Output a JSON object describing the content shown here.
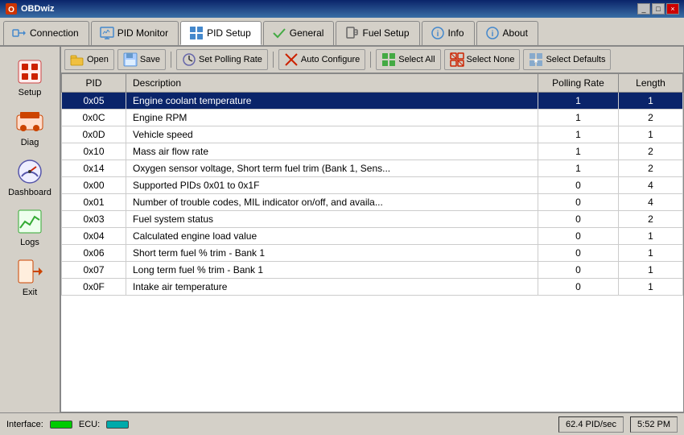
{
  "titlebar": {
    "title": "OBDwiz",
    "controls": [
      "_",
      "□",
      "×"
    ]
  },
  "nav": {
    "tabs": [
      {
        "id": "connection",
        "label": "Connection",
        "icon": "plug"
      },
      {
        "id": "pid-monitor",
        "label": "PID Monitor",
        "icon": "monitor"
      },
      {
        "id": "pid-setup",
        "label": "PID Setup",
        "icon": "grid",
        "active": true
      },
      {
        "id": "general",
        "label": "General",
        "icon": "check"
      },
      {
        "id": "fuel-setup",
        "label": "Fuel Setup",
        "icon": "fuel"
      },
      {
        "id": "info",
        "label": "Info",
        "icon": "info"
      },
      {
        "id": "about",
        "label": "About",
        "icon": "info2"
      }
    ]
  },
  "sidebar": {
    "items": [
      {
        "id": "setup",
        "label": "Setup",
        "icon": "wrench"
      },
      {
        "id": "diag",
        "label": "Diag",
        "icon": "car"
      },
      {
        "id": "dashboard",
        "label": "Dashboard",
        "icon": "gauge"
      },
      {
        "id": "logs",
        "label": "Logs",
        "icon": "graph"
      },
      {
        "id": "exit",
        "label": "Exit",
        "icon": "arrow"
      }
    ]
  },
  "toolbar": {
    "buttons": [
      {
        "id": "open",
        "label": "Open",
        "icon": "folder"
      },
      {
        "id": "save",
        "label": "Save",
        "icon": "disk"
      },
      {
        "id": "set-polling-rate",
        "label": "Set Polling Rate",
        "icon": "clock"
      },
      {
        "id": "auto-configure",
        "label": "Auto Configure",
        "icon": "x-mark"
      },
      {
        "id": "select-all",
        "label": "Select All",
        "icon": "check-grid"
      },
      {
        "id": "select-none",
        "label": "Select None",
        "icon": "x-grid"
      },
      {
        "id": "select-defaults",
        "label": "Select Defaults",
        "icon": "grid-star"
      }
    ]
  },
  "table": {
    "columns": [
      "PID",
      "Description",
      "Polling Rate",
      "Length"
    ],
    "rows": [
      {
        "pid": "0x05",
        "description": "Engine coolant temperature",
        "polling": "1",
        "length": "1",
        "selected": true
      },
      {
        "pid": "0x0C",
        "description": "Engine RPM",
        "polling": "1",
        "length": "2",
        "selected": false
      },
      {
        "pid": "0x0D",
        "description": "Vehicle speed",
        "polling": "1",
        "length": "1",
        "selected": false
      },
      {
        "pid": "0x10",
        "description": "Mass air flow rate",
        "polling": "1",
        "length": "2",
        "selected": false
      },
      {
        "pid": "0x14",
        "description": "Oxygen sensor voltage, Short term fuel trim (Bank 1, Sens...",
        "polling": "1",
        "length": "2",
        "selected": false
      },
      {
        "pid": "0x00",
        "description": "Supported PIDs 0x01 to 0x1F",
        "polling": "0",
        "length": "4",
        "selected": false
      },
      {
        "pid": "0x01",
        "description": "Number of trouble codes, MIL indicator on/off, and availa...",
        "polling": "0",
        "length": "4",
        "selected": false
      },
      {
        "pid": "0x03",
        "description": "Fuel system status",
        "polling": "0",
        "length": "2",
        "selected": false
      },
      {
        "pid": "0x04",
        "description": "Calculated engine load value",
        "polling": "0",
        "length": "1",
        "selected": false
      },
      {
        "pid": "0x06",
        "description": "Short term fuel % trim - Bank 1",
        "polling": "0",
        "length": "1",
        "selected": false
      },
      {
        "pid": "0x07",
        "description": "Long term fuel % trim - Bank 1",
        "polling": "0",
        "length": "1",
        "selected": false
      },
      {
        "pid": "0x0F",
        "description": "Intake air temperature",
        "polling": "0",
        "length": "1",
        "selected": false
      }
    ]
  },
  "statusbar": {
    "interface_label": "Interface:",
    "ecu_label": "ECU:",
    "pid_rate": "62.4 PID/sec",
    "time": "5:52 PM"
  }
}
